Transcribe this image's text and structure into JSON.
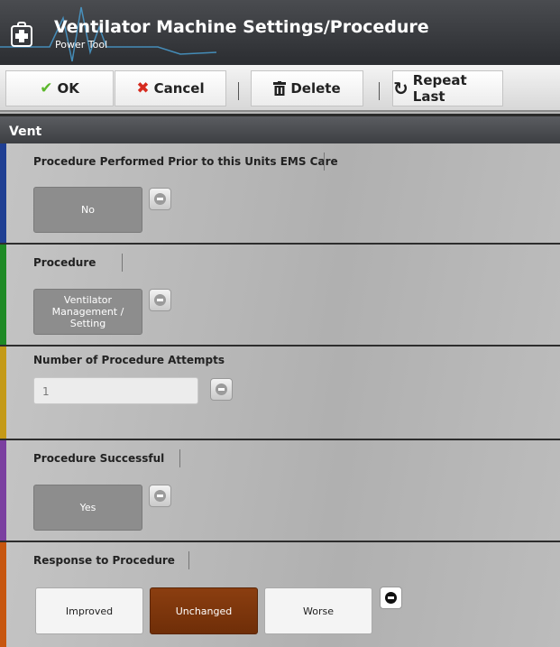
{
  "header": {
    "title": "Ventilator Machine Settings/Procedure",
    "subtitle": "Power Tool"
  },
  "toolbar": {
    "ok_label": "OK",
    "cancel_label": "Cancel",
    "delete_label": "Delete",
    "repeat_label": "Repeat Last"
  },
  "section": {
    "title": "Vent"
  },
  "fields": {
    "prior": {
      "label": "Procedure Performed Prior to this Units EMS Care",
      "value": "No",
      "stripe": "#1f3f93"
    },
    "procedure": {
      "label": "Procedure",
      "value_line1": "Ventilator",
      "value_line2": "Management / Setting",
      "stripe": "#1e8a25"
    },
    "attempts": {
      "label": "Number of Procedure Attempts",
      "value": "1",
      "stripe": "#c49a17"
    },
    "successful": {
      "label": "Procedure Successful",
      "value": "Yes",
      "stripe": "#7b3fa0"
    },
    "response": {
      "label": "Response to Procedure",
      "stripe": "#c7560f",
      "options": [
        "Improved",
        "Unchanged",
        "Worse"
      ],
      "selected": "Unchanged"
    }
  },
  "colors": {
    "accent_selected": "#7e370c",
    "ok_check": "#5cb82c",
    "cancel_x": "#d62b1f"
  }
}
